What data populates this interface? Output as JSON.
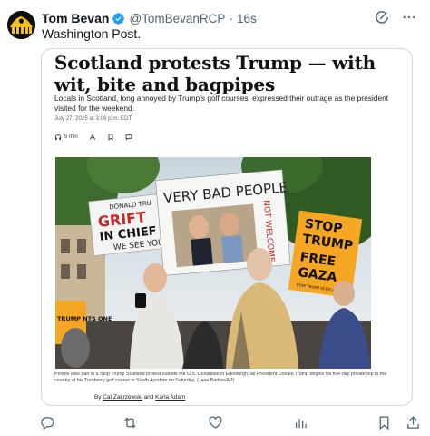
{
  "tweet": {
    "author_name": "Tom Bevan",
    "author_handle": "@TomBevanRCP",
    "separator": "·",
    "timestamp": "16s",
    "text": "Washington Post."
  },
  "article": {
    "headline": "Scotland protests Trump — with wit, bite and bagpipes",
    "dek": "Locals in Scotland, long annoyed by Trump’s golf courses, expressed their outrage as the president visited for the weekend.",
    "date": "July 27, 2025 at 3:06 p.m. EDT",
    "read_time": "5 min",
    "caption": "People take part in a Stop Trump Scotland protest outside the U.S. Consulate in Edinburgh, as President Donald Trump begins his five-day private trip to the country at his Turnberry golf course in South Ayrshire on Saturday. (Jane Barlow/AP)",
    "byline_prefix": "By",
    "author1": "Cat Zakrzewski",
    "byline_and": "and",
    "author2": "Karla Adam"
  },
  "photo_signs": {
    "sign_left_line1": "DONALD TRU",
    "sign_left_line2": "GRIFT",
    "sign_left_line3": "IN CHIEF",
    "sign_left_line4": "WE SEE YOU",
    "sign_main": "VERY BAD PEOPLE",
    "sign_vertical": "NOT WELCOME",
    "sign_right_1": "STOP",
    "sign_right_2": "TRUMP",
    "sign_right_3": "FREE",
    "sign_right_4": "GAZA",
    "sign_right_small": "STOP TRUMP SCOTLAND",
    "sign_bottom_left": "TRUMP NTS ONE"
  },
  "colors": {
    "verified_blue": "#1d9bf0",
    "text_secondary": "#536471",
    "border": "#cfd9de",
    "sign_orange": "#f5a623"
  },
  "icons": {
    "header_action": "grok-icon",
    "more": "more-icon",
    "reply": "reply-icon",
    "repost": "repost-icon",
    "like": "like-icon",
    "views": "views-icon",
    "bookmark": "bookmark-icon",
    "share": "share-icon"
  }
}
